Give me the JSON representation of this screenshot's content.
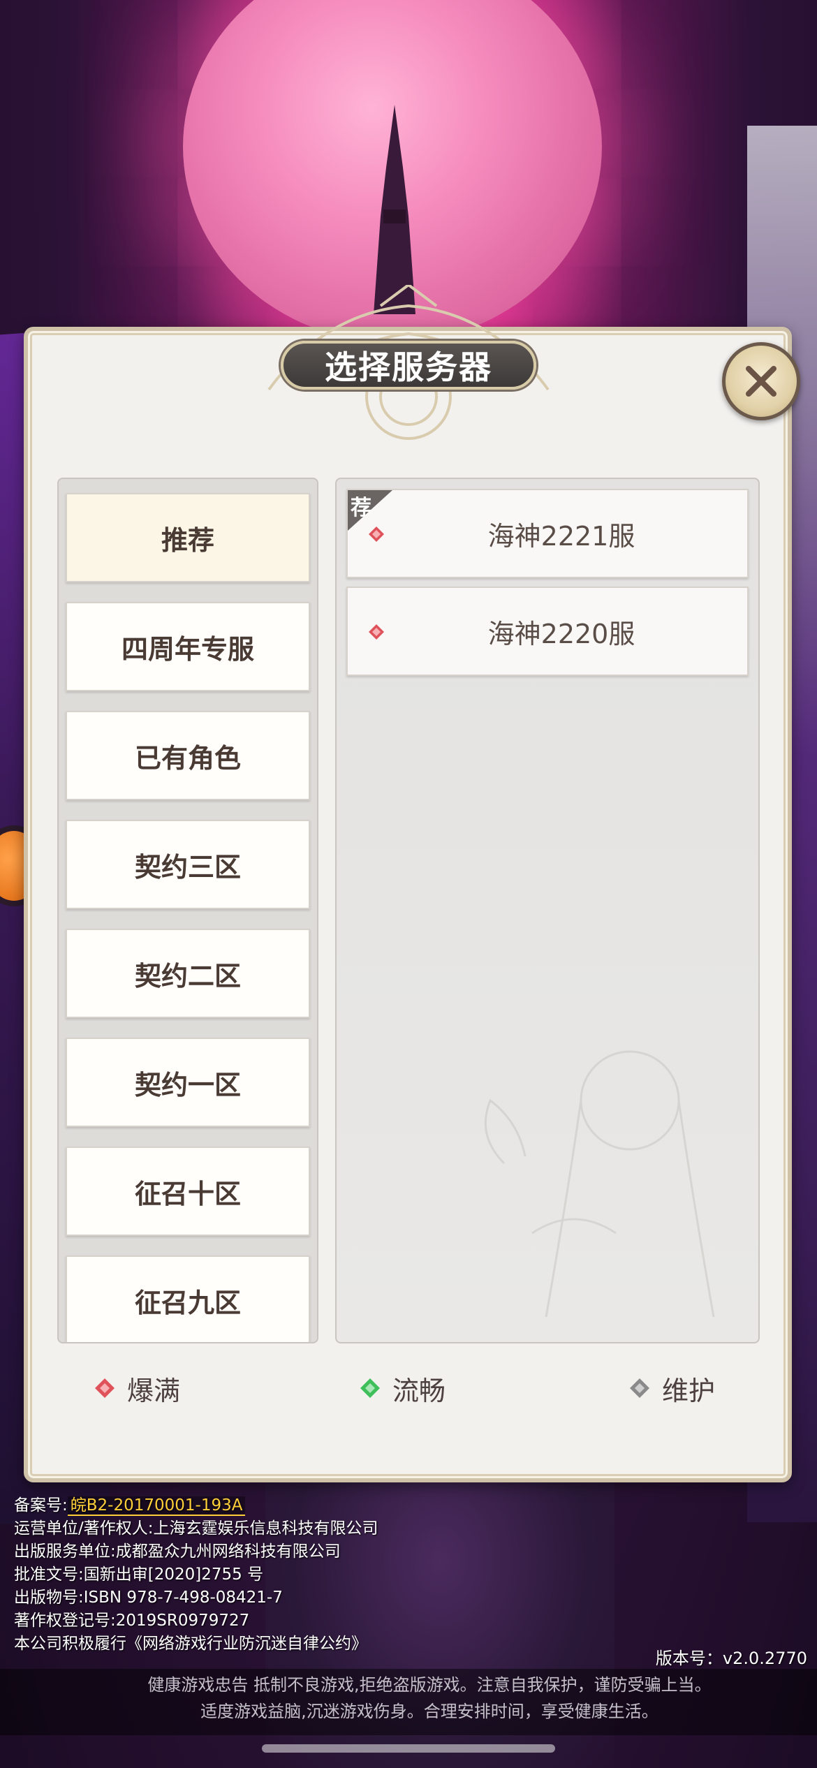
{
  "dialog": {
    "title": "选择服务器"
  },
  "tabs": [
    {
      "label": "推荐",
      "active": true
    },
    {
      "label": "四周年专服",
      "active": false
    },
    {
      "label": "已有角色",
      "active": false
    },
    {
      "label": "契约三区",
      "active": false
    },
    {
      "label": "契约二区",
      "active": false
    },
    {
      "label": "契约一区",
      "active": false
    },
    {
      "label": "征召十区",
      "active": false
    },
    {
      "label": "征召九区",
      "active": false
    }
  ],
  "servers": [
    {
      "name": "海神2221服",
      "status": "爆满",
      "badge": "荐"
    },
    {
      "name": "海神2220服",
      "status": "爆满",
      "badge": ""
    }
  ],
  "legend": [
    {
      "label": "爆满",
      "color": "#e0525a"
    },
    {
      "label": "流畅",
      "color": "#3fbf5a"
    },
    {
      "label": "维护",
      "color": "#8a8a8a"
    }
  ],
  "footer": {
    "icp_label": "备案号:",
    "icp_value": "皖B2-20170001-193A",
    "lines": [
      "运营单位/著作权人:上海玄霆娱乐信息科技有限公司",
      "出版服务单位:成都盈众九州网络科技有限公司",
      "批准文号:国新出审[2020]2755 号",
      "出版物号:ISBN 978-7-498-08421-7",
      "著作权登记号:2019SR0979727",
      "本公司积极履行《网络游戏行业防沉迷自律公约》"
    ],
    "version": "版本号：v2.0.2770",
    "health_line1": "健康游戏忠告   抵制不良游戏,拒绝盗版游戏。注意自我保护，谨防受骗上当。",
    "health_line2": "适度游戏益脑,沉迷游戏伤身。合理安排时间，享受健康生活。"
  },
  "colors": {
    "status_full": "#e0525a",
    "status_smooth": "#3fbf5a",
    "status_maintenance": "#8a8a8a",
    "icp_highlight": "#ffcf3a"
  }
}
